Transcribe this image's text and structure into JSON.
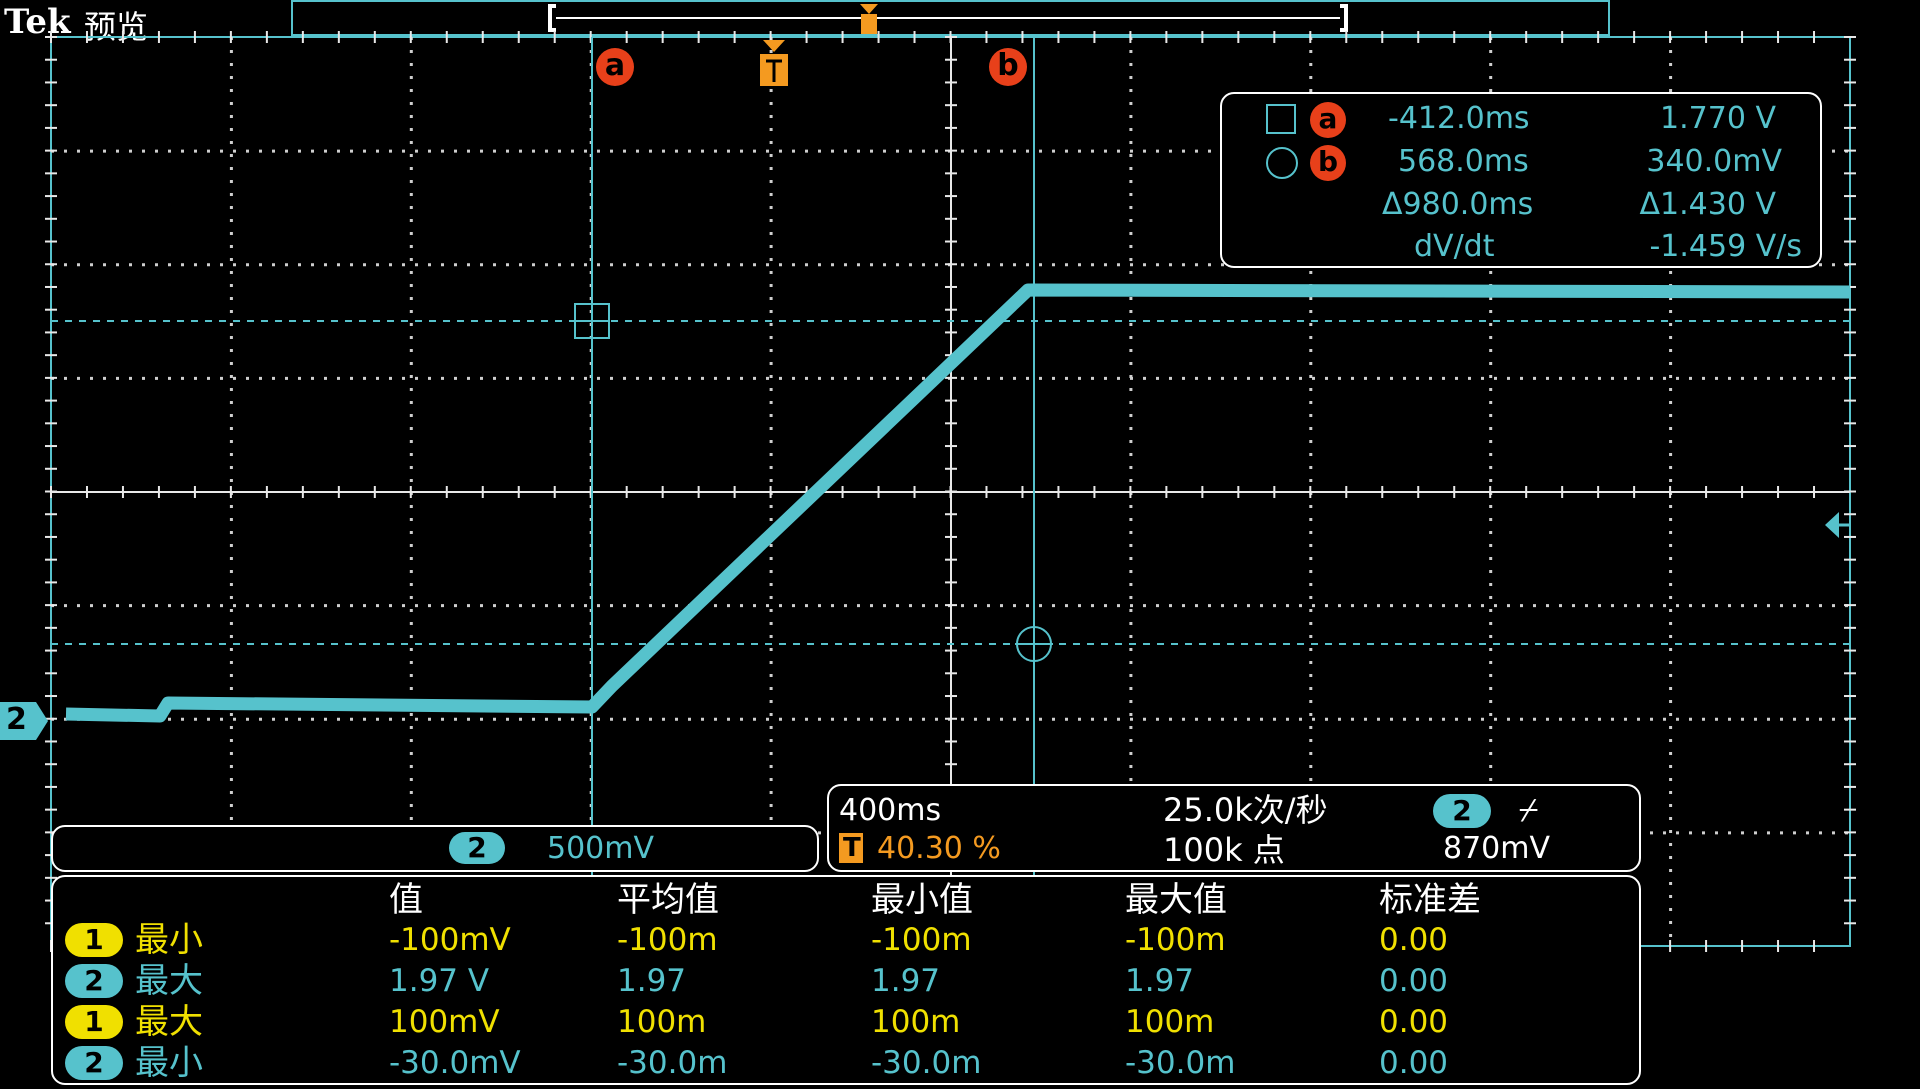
{
  "header": {
    "brand": "Tek",
    "mode": "预览"
  },
  "markers": {
    "cursor_a": "a",
    "cursor_b": "b",
    "trigger": "T",
    "channel": "2"
  },
  "cursor_readout": {
    "a_time": "-412.0ms",
    "a_volt": "1.770 V",
    "b_time": "568.0ms",
    "b_volt": "340.0mV",
    "delta_time": "Δ980.0ms",
    "delta_volt": "Δ1.430 V",
    "rate_label": "dV/dt",
    "rate_value": "-1.459 V/s"
  },
  "channel_panel": {
    "channel": "2",
    "scale": "500mV"
  },
  "horizontal_panel": {
    "timebase": "400ms",
    "trigger_label": "T",
    "trigger_position": "40.30 %",
    "sample_rate": "25.0k次/秒",
    "record_length": "100k 点",
    "trigger_channel": "2",
    "trigger_slope": "⌿",
    "trigger_level": "870mV"
  },
  "measurements": {
    "headers": [
      "值",
      "平均值",
      "最小值",
      "最大值",
      "标准差"
    ],
    "rows": [
      {
        "ch": "1",
        "name": "最小",
        "value": "-100mV",
        "mean": "-100m",
        "min": "-100m",
        "max": "-100m",
        "std": "0.00"
      },
      {
        "ch": "2",
        "name": "最大",
        "value": "1.97 V",
        "mean": "1.97",
        "min": "1.97",
        "max": "1.97",
        "std": "0.00"
      },
      {
        "ch": "1",
        "name": "最大",
        "value": "100mV",
        "mean": "100m",
        "min": "100m",
        "max": "100m",
        "std": "0.00"
      },
      {
        "ch": "2",
        "name": "最小",
        "value": "-30.0mV",
        "mean": "-30.0m",
        "min": "-30.0m",
        "max": "-30.0m",
        "std": "0.00"
      }
    ]
  },
  "colors": {
    "ch1": "#f0e000",
    "ch2": "#56c2cc",
    "cursor": "#e8401a",
    "trigger": "#f49a20",
    "grid": "#e8e8e8"
  }
}
